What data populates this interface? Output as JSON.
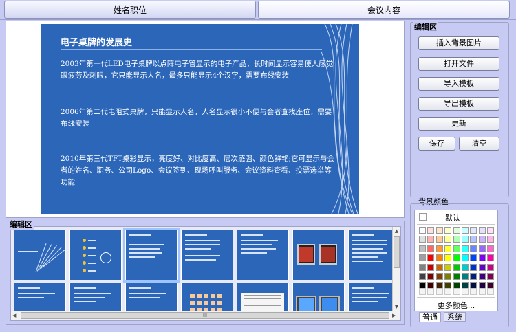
{
  "tabs": [
    {
      "label": "姓名职位",
      "active": false
    },
    {
      "label": "会议内容",
      "active": true
    }
  ],
  "slide": {
    "title": "电子桌牌的发展史",
    "paragraphs": [
      "2003年第一代LED电子桌牌以点阵电子管显示的电子产品，长时间显示容易使人感觉眼疲劳及刺眼，它只能显示人名，最多只能显示4个汉字，需要布线安装",
      "2006年第二代电阻式桌牌，只能显示人名，人名显示很小不便与会者查找座位，需要布线安装",
      "2010年第三代TFT桌彩显示，亮度好、对比度高、层次感强、颜色鲜艳;它可显示与会者的姓名、职务、公司Logo、会议签到、现场呼叫服务、会议资料查看、投票选举等功能"
    ]
  },
  "edit_panel": {
    "label": "编辑区",
    "buttons": {
      "insert_bg": "插入背景图片",
      "open_file": "打开文件",
      "import_template": "导入模板",
      "export_template": "导出模板",
      "update": "更新",
      "save": "保存",
      "clear": "清空"
    }
  },
  "thumbs_panel": {
    "label": "编辑区",
    "hscroll_grip": "III"
  },
  "bg_color": {
    "label": "背景颜色",
    "default_label": "默认",
    "more_colors": "更多颜色...",
    "tab_normal": "普通",
    "tab_system": "系统",
    "swatches": [
      [
        "#ffffff",
        "#ffe0e0",
        "#ffe6cc",
        "#ffffcc",
        "#e0ffe0",
        "#ccffff",
        "#e0e8ff",
        "#e6e0ff",
        "#ffe0f6"
      ],
      [
        "#e0e0e0",
        "#ffb3b3",
        "#ffcc99",
        "#ffff99",
        "#b3ffb3",
        "#99ffff",
        "#b3c6ff",
        "#ccb3ff",
        "#ffb3e6"
      ],
      [
        "#c0c0c0",
        "#ff6666",
        "#ff9933",
        "#ffff33",
        "#66ff66",
        "#33ffff",
        "#6688ff",
        "#9966ff",
        "#ff66cc"
      ],
      [
        "#a0a0a0",
        "#ff0000",
        "#ff8000",
        "#ffff00",
        "#00ff00",
        "#00ffff",
        "#0044ff",
        "#8000ff",
        "#ff00aa"
      ],
      [
        "#808080",
        "#cc0000",
        "#cc6600",
        "#cccc00",
        "#00cc00",
        "#00cccc",
        "#0033cc",
        "#6600cc",
        "#cc0088"
      ],
      [
        "#404040",
        "#800000",
        "#804000",
        "#808000",
        "#008000",
        "#008080",
        "#002080",
        "#400080",
        "#800055"
      ],
      [
        "#000000",
        "#400000",
        "#402000",
        "#404000",
        "#004000",
        "#004040",
        "#001040",
        "#200040",
        "#400028"
      ]
    ]
  }
}
